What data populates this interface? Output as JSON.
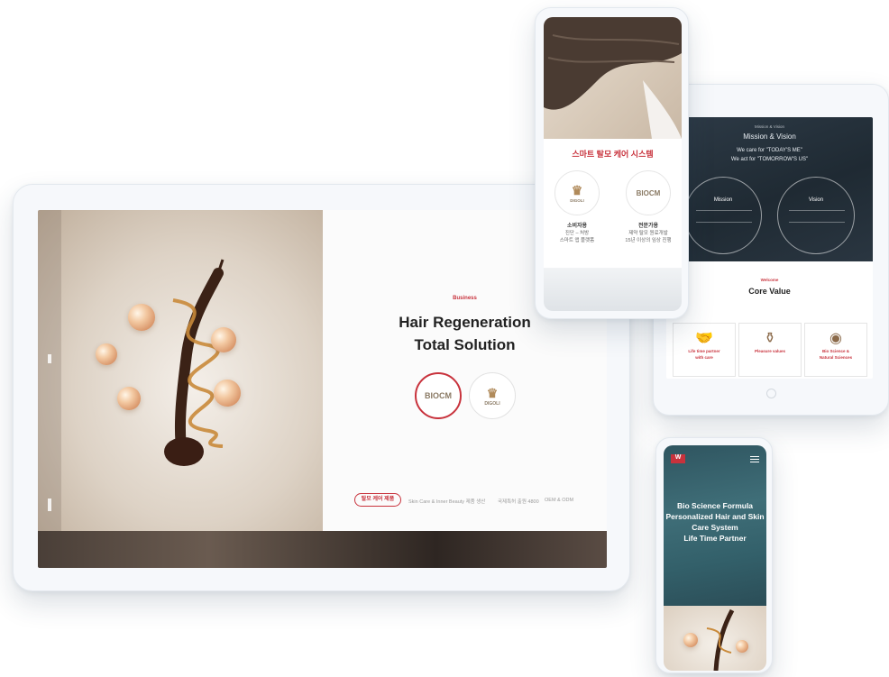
{
  "tablet_main": {
    "eyebrow": "Business",
    "headline_line1": "Hair Regeneration",
    "headline_line2": "Total Solution",
    "logo_left": "BIOCM",
    "logo_right": "DIGOLI",
    "pill_label": "탈모 케어 제품",
    "meta_1": "Skin Care & Inner Beauty 제품 생산",
    "meta_2": "국제특허 출원 4800",
    "meta_3": "OEM & ODM"
  },
  "phone_top": {
    "title": "스마트 탈모 케어 시스템",
    "logo_left": "DIGOLI",
    "logo_right": "BIOCM",
    "col_left_heading": "소비자용",
    "col_left_line1": "진단 – 처방",
    "col_left_line2": "스마트 앱 플랫폼",
    "col_right_heading": "전문가용",
    "col_right_line1": "제약 탈모 원료개발",
    "col_right_line2": "15년 이상의 임상 진행"
  },
  "tablet_right": {
    "kicker": "Mission & Vision",
    "heading": "Mission & Vision",
    "line1": "We care for \"TODAY'S ME\"",
    "line2": "We act for \"TOMORROW'S US\"",
    "mission_label": "Mission",
    "vision_label": "Vision",
    "core_kicker": "Welcome",
    "core_heading": "Core Value",
    "cv1_text": "Life time partner",
    "cv1_sub": "with care",
    "cv2_text": "Pleasure values",
    "cv3_text": "Bio Science &",
    "cv3_sub": "Natural Sciences"
  },
  "phone_bottom": {
    "logo": "W",
    "line1": "Bio Science Formula",
    "line2": "Personalized Hair and Skin",
    "line3": "Care System",
    "line4": "Life Time Partner"
  },
  "colors": {
    "accent": "#c8323c",
    "dark_panel": "#1f2a33",
    "teal_panel": "#3f6e78"
  }
}
